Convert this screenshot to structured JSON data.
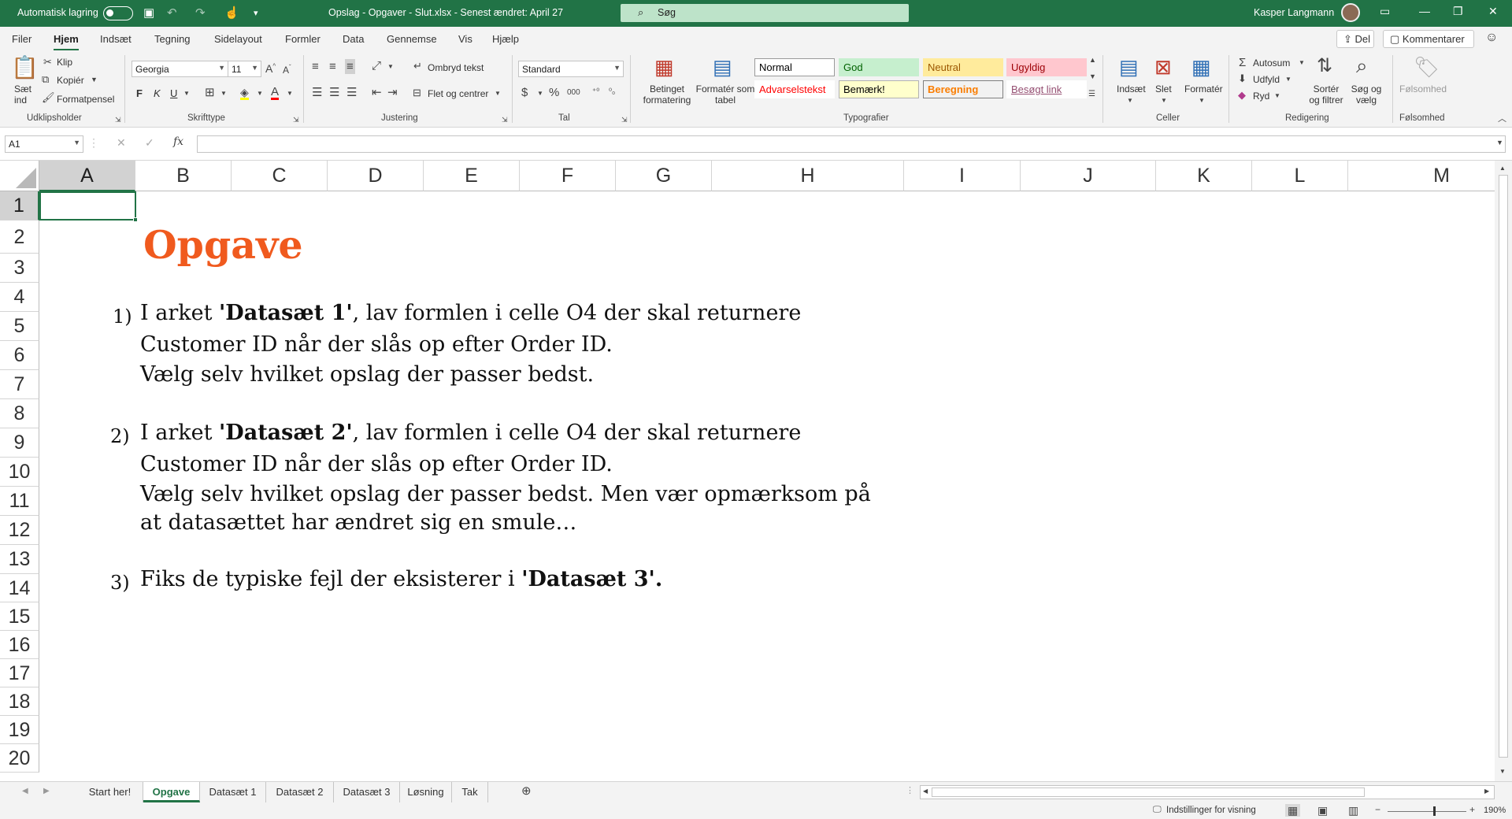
{
  "titlebar": {
    "autosave_label": "Automatisk lagring",
    "doc_title": "Opslag - Opgaver - Slut.xlsx  -  Senest ændret: April 27",
    "search_placeholder": "Søg",
    "user_name": "Kasper Langmann"
  },
  "menu": {
    "tabs": [
      "Filer",
      "Hjem",
      "Indsæt",
      "Tegning",
      "Sidelayout",
      "Formler",
      "Data",
      "Gennemse",
      "Vis",
      "Hjælp"
    ],
    "active_tab": "Hjem",
    "share_label": "Del",
    "comments_label": "Kommentarer"
  },
  "ribbon": {
    "clipboard": {
      "paste": "Sæt ind",
      "cut": "Klip",
      "copy": "Kopiér",
      "format_painter": "Formatpensel",
      "group": "Udklipsholder"
    },
    "font": {
      "name": "Georgia",
      "size": "11",
      "bold": "F",
      "italic": "K",
      "underline": "U",
      "group": "Skrifttype"
    },
    "alignment": {
      "wrap": "Ombryd tekst",
      "merge": "Flet og centrer",
      "group": "Justering"
    },
    "number": {
      "format": "Standard",
      "group": "Tal"
    },
    "styles": {
      "conditional": "Betinget formatering",
      "as_table": "Formatér som tabel",
      "group": "Typografier",
      "cells": [
        {
          "label": "Normal",
          "bg": "#ffffff",
          "fg": "#000000",
          "border": "#9a9a9a"
        },
        {
          "label": "God",
          "bg": "#c6efce",
          "fg": "#006100",
          "border": "#c6efce"
        },
        {
          "label": "Neutral",
          "bg": "#ffeb9c",
          "fg": "#9c5700",
          "border": "#ffeb9c"
        },
        {
          "label": "Ugyldig",
          "bg": "#ffc7ce",
          "fg": "#9c0006",
          "border": "#ffc7ce"
        },
        {
          "label": "Advarselstekst",
          "bg": "#ffffff",
          "fg": "#ff0000",
          "border": "#ffffff"
        },
        {
          "label": "Bemærk!",
          "bg": "#ffffcc",
          "fg": "#000000",
          "border": "#b2b2b2"
        },
        {
          "label": "Beregning",
          "bg": "#f2f2f2",
          "fg": "#fa7d00",
          "border": "#7f7f7f"
        },
        {
          "label": "Besøgt link",
          "bg": "#ffffff",
          "fg": "#954f72",
          "border": "#ffffff"
        }
      ]
    },
    "cells": {
      "insert": "Indsæt",
      "delete": "Slet",
      "format": "Formatér",
      "group": "Celler"
    },
    "editing": {
      "autosum": "Autosum",
      "fill": "Udfyld",
      "clear": "Ryd",
      "sort": "Sortér og filtrer",
      "find": "Søg og vælg",
      "group": "Redigering"
    },
    "sensitivity": {
      "label": "Følsomhed",
      "group": "Følsomhed"
    }
  },
  "formula_bar": {
    "name_box": "A1",
    "formula": ""
  },
  "grid": {
    "columns": [
      "A",
      "B",
      "C",
      "D",
      "E",
      "F",
      "G",
      "H",
      "I",
      "J",
      "K",
      "L",
      "M"
    ],
    "selected_column": "A",
    "rows": [
      "1",
      "2",
      "3",
      "4",
      "5",
      "6",
      "7",
      "8",
      "9",
      "10",
      "11",
      "12",
      "13",
      "14",
      "15",
      "16",
      "17",
      "18",
      "19",
      "20"
    ],
    "selected_row": "1",
    "title": "Opgave",
    "title_color": "#f05a1e",
    "tasks": [
      {
        "num": "1)",
        "line1": {
          "a": "I arket ",
          "b": "'Datasæt 1'",
          "c": ", lav formlen i celle O4 der skal returnere"
        },
        "rest": [
          "Customer ID når der slås op efter Order ID.",
          "Vælg selv hvilket opslag der passer bedst."
        ]
      },
      {
        "num": "2)",
        "line1": {
          "a": "I arket ",
          "b": "'Datasæt 2'",
          "c": ", lav formlen i celle O4 der skal returnere"
        },
        "rest": [
          "Customer ID når der slås op efter Order ID.",
          "Vælg selv hvilket opslag der passer bedst. Men vær opmærksom på",
          "at datasættet har ændret sig en smule…"
        ]
      },
      {
        "num": "3)",
        "line1": {
          "a": "Fiks de typiske fejl der eksisterer i ",
          "b": "'Datasæt 3'",
          "c": "."
        },
        "rest": []
      }
    ]
  },
  "sheets": {
    "tabs": [
      "Start her!",
      "Opgave",
      "Datasæt 1",
      "Datasæt 2",
      "Datasæt 3",
      "Løsning",
      "Tak"
    ],
    "active": "Opgave"
  },
  "status": {
    "display_settings": "Indstillinger for visning",
    "zoom": "190%"
  },
  "accent_color": "#217346"
}
